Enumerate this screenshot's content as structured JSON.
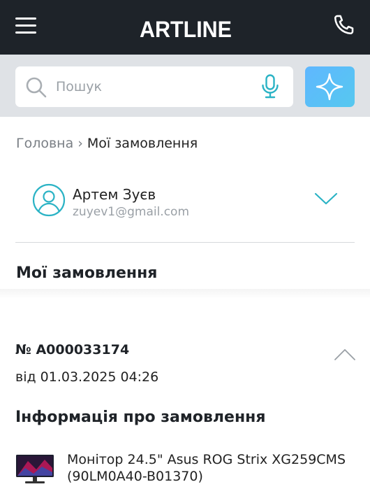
{
  "header": {
    "logo_text": "ARTLINE",
    "menu_icon": "hamburger-menu-icon",
    "phone_icon": "phone-icon"
  },
  "search": {
    "placeholder": "Пошук",
    "search_icon": "magnifier-icon",
    "mic_icon": "microphone-icon",
    "ai_icon": "sparkle-icon"
  },
  "breadcrumb": {
    "home": "Головна",
    "separator": "›",
    "current": "Мої замовлення"
  },
  "user": {
    "name": "Артем Зуєв",
    "email": "zuyev1@gmail.com"
  },
  "page": {
    "title": "Мої замовлення"
  },
  "order": {
    "number": "№ A000033174",
    "date": "від 01.03.2025 04:26",
    "info_title": "Інформація про замовлення",
    "product": {
      "name": "Монітор 24.5\" Asus ROG Strix XG259CMS (90LM0A40-B01370)"
    }
  },
  "colors": {
    "header_bg": "#1e2329",
    "search_bar_bg": "#dfe2e6",
    "accent_teal": "#2bb3c5",
    "ai_button": "#56c8ef"
  }
}
